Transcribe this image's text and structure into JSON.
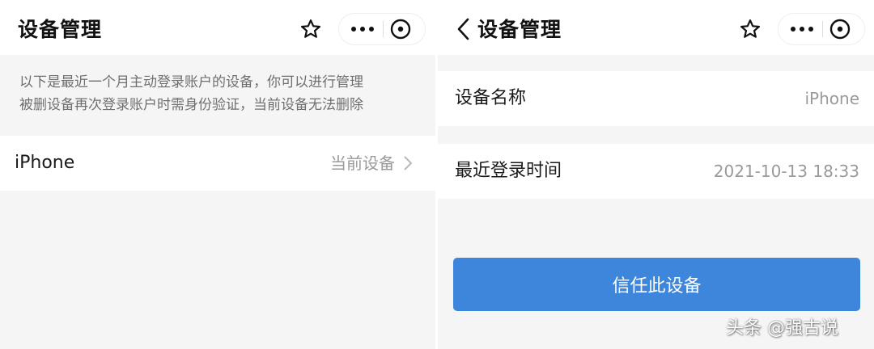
{
  "left": {
    "nav": {
      "title": "设备管理"
    },
    "notice": {
      "line1": "以下是最近一个月主动登录账户的设备，你可以进行管理",
      "line2": "被删设备再次登录账户时需身份验证，当前设备无法删除"
    },
    "devices": [
      {
        "name": "iPhone",
        "status": "当前设备"
      }
    ]
  },
  "right": {
    "nav": {
      "title": "设备管理"
    },
    "fields": [
      {
        "label": "设备名称",
        "value": "iPhone"
      },
      {
        "label": "最近登录时间",
        "value": "2021-10-13 18:33"
      }
    ],
    "trust_button": "信任此设备"
  },
  "watermark": "头条 @强古说",
  "icons": [
    "star-icon",
    "more-dots-icon",
    "close-circle-icon",
    "back-arrow-icon",
    "chevron-right-icon"
  ],
  "colors": {
    "background": "#f5f5f5",
    "card": "#ffffff",
    "primary_button": "#3e86dc",
    "text_primary": "#1a1a1a",
    "text_secondary": "#9a9a9a"
  }
}
